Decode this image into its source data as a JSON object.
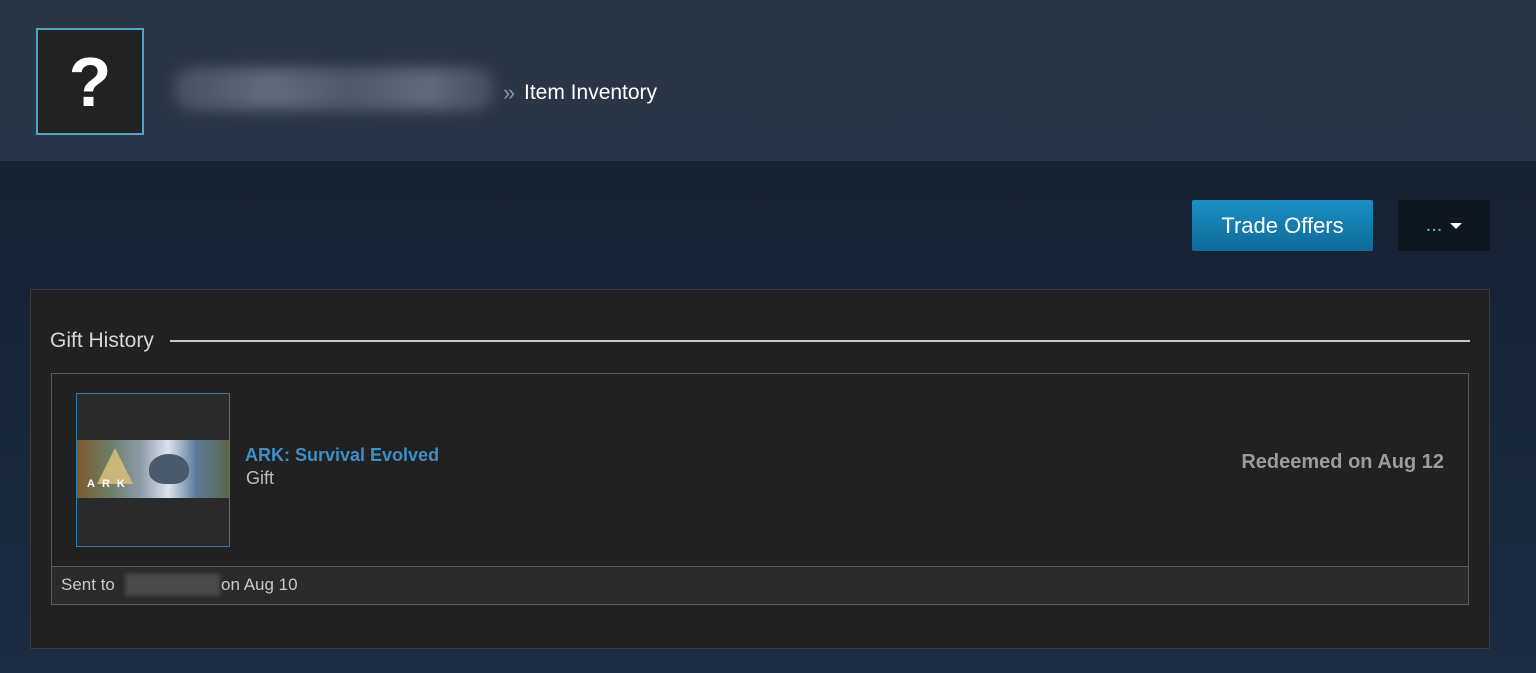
{
  "header": {
    "avatar_glyph": "?",
    "breadcrumb_separator": "»",
    "page_title": "Item Inventory"
  },
  "actions": {
    "trade_offers_label": "Trade Offers",
    "more_label": "..."
  },
  "gift_history": {
    "title": "Gift History",
    "items": [
      {
        "game_title": "ARK: Survival Evolved",
        "art_text": "ARK",
        "type": "Gift",
        "status": "Redeemed on Aug 12",
        "sent_prefix": "Sent to",
        "sent_date": "on Aug 10"
      }
    ]
  },
  "colors": {
    "page_bg": "#1b2838",
    "accent_blue": "#1a8fc4",
    "link_blue": "#3f8ec7",
    "panel_bg": "#212121"
  },
  "icons": {
    "avatar": "question-mark-icon",
    "more": "caret-down-icon"
  }
}
